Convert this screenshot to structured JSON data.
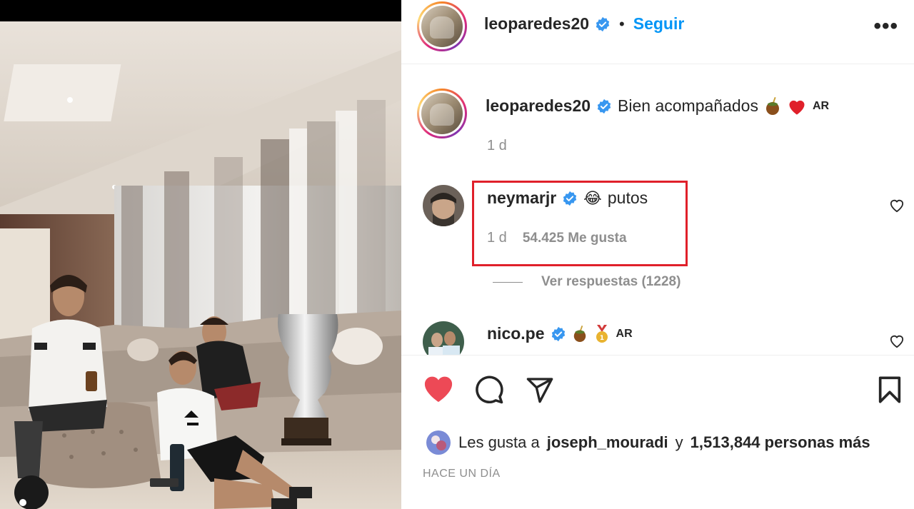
{
  "post": {
    "author": "leoparedes20",
    "dot": "•",
    "follow_label": "Seguir",
    "more_label": "•••"
  },
  "caption": {
    "author": "leoparedes20",
    "text": "Bien acompañados",
    "emojis": [
      "mate",
      "red-heart"
    ],
    "flag_text": "AR",
    "time": "1 d"
  },
  "comments": [
    {
      "author": "neymarjr",
      "emoji": "😂",
      "text": "putos",
      "time": "1 d",
      "likes": "54.425 Me gusta"
    },
    {
      "author": "nico.pe",
      "emojis": [
        "mate",
        "medal"
      ],
      "flag_text": "AR"
    }
  ],
  "replies": {
    "label": "Ver respuestas (1228)"
  },
  "likes": {
    "prefix": "Les gusta a",
    "user": "joseph_mouradi",
    "connector": "y",
    "count_text": "1,513,844 personas más"
  },
  "posted": "HACE UN DÍA",
  "colors": {
    "follow": "#0095f6",
    "verified": "#3897f0",
    "like_filled": "#ed4956",
    "highlight_box": "#e0202a",
    "muted": "#8e8e8e"
  }
}
